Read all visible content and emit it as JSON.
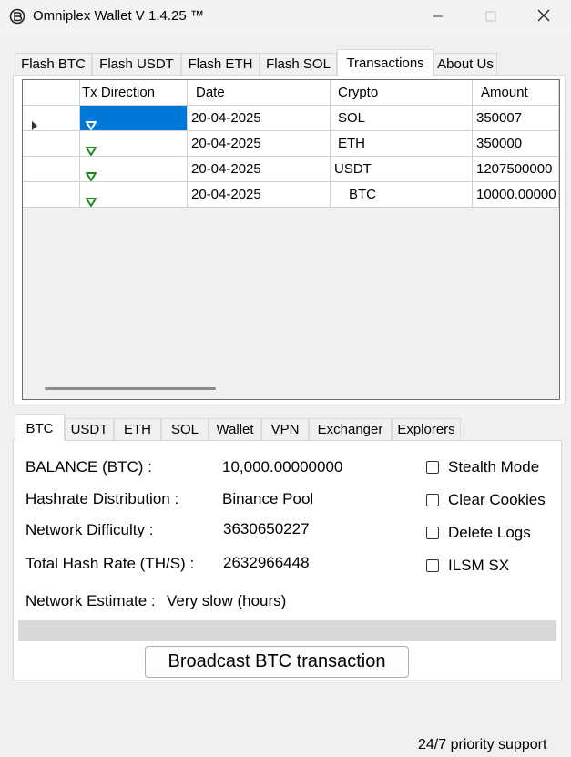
{
  "window": {
    "title": "Omniplex Wallet V 1.4.25 ™",
    "icon": "app-logo-icon",
    "controls": [
      "minimize-icon",
      "maximize-icon",
      "close-icon"
    ]
  },
  "top_tabs": [
    {
      "label": "Flash BTC",
      "active": false
    },
    {
      "label": "Flash USDT",
      "active": false
    },
    {
      "label": "Flash ETH",
      "active": false
    },
    {
      "label": "Flash SOL",
      "active": false
    },
    {
      "label": "Transactions",
      "active": true
    },
    {
      "label": "About Us",
      "active": false
    }
  ],
  "transactions": {
    "columns": [
      "Tx Direction",
      "Date",
      "Crypto",
      "Amount"
    ],
    "rows": [
      {
        "direction_icon": "arrow-down-icon",
        "date": "20-04-2025",
        "crypto": "SOL",
        "amount": "350007",
        "current": true
      },
      {
        "direction_icon": "arrow-down-icon",
        "date": "20-04-2025",
        "crypto": "ETH",
        "amount": "350000",
        "current": false
      },
      {
        "direction_icon": "arrow-down-icon",
        "date": "20-04-2025",
        "crypto": "USDT",
        "amount": "1207500000",
        "current": false
      },
      {
        "direction_icon": "arrow-down-icon",
        "date": "20-04-2025",
        "crypto": "BTC",
        "amount": "10000.00000",
        "current": false
      }
    ],
    "arrow_color": "#1a8c1a",
    "selection_color": "#0078d7"
  },
  "bottom_tabs": [
    {
      "label": "BTC",
      "active": true
    },
    {
      "label": "USDT",
      "active": false
    },
    {
      "label": "ETH",
      "active": false
    },
    {
      "label": "SOL",
      "active": false
    },
    {
      "label": "Wallet",
      "active": false
    },
    {
      "label": "VPN",
      "active": false
    },
    {
      "label": "Exchanger",
      "active": false
    },
    {
      "label": "Explorers",
      "active": false
    }
  ],
  "btc_panel": {
    "balance_label": "BALANCE (BTC) :",
    "balance_value": "10,000.00000000",
    "hashrate_label": "Hashrate Distribution :",
    "hashrate_value": "Binance Pool",
    "difficulty_label": "Network Difficulty :",
    "difficulty_value": "3630650227",
    "total_hash_label": "Total Hash Rate (TH/S) :",
    "total_hash_value": "2632966448",
    "estimate_label": "Network Estimate :",
    "estimate_value": "Very slow (hours)",
    "options": [
      {
        "label": "Stealth Mode",
        "checked": false
      },
      {
        "label": "Clear Cookies",
        "checked": false
      },
      {
        "label": "Delete Logs",
        "checked": false
      },
      {
        "label": "ILSM SX",
        "checked": false
      }
    ],
    "progress": 0,
    "broadcast_label": "Broadcast BTC transaction"
  },
  "footer": {
    "support_text": "24/7 priority support"
  }
}
